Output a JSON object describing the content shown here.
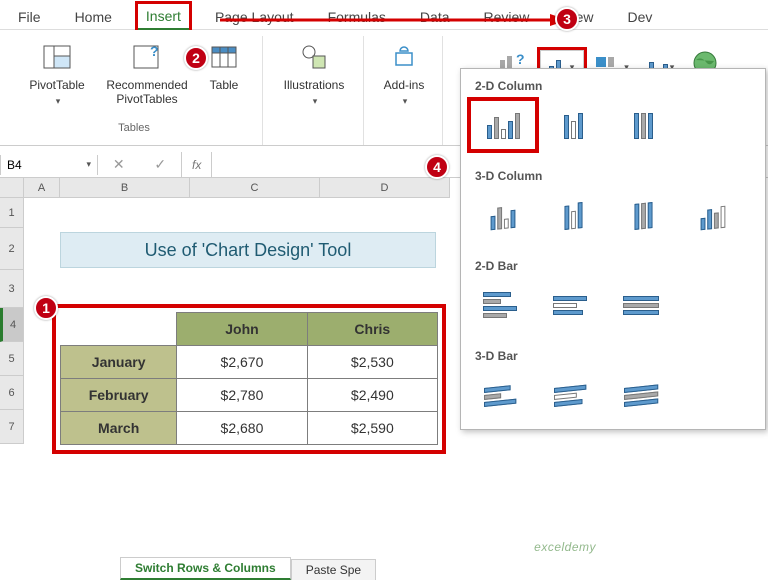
{
  "tabs": {
    "file": "File",
    "home": "Home",
    "insert": "Insert",
    "pagelayout": "Page Layout",
    "formulas": "Formulas",
    "data": "Data",
    "review": "Review",
    "view": "View",
    "dev": "Dev"
  },
  "ribbon": {
    "pivot": "PivotTable",
    "recpivot": "Recommended PivotTables",
    "table": "Table",
    "illus": "Illustrations",
    "addins": "Add-ins",
    "group_tables": "Tables"
  },
  "namebox": "B4",
  "fx": "fx",
  "title": "Use of 'Chart Design' Tool",
  "cols": [
    "A",
    "B",
    "C",
    "D"
  ],
  "rows": [
    "1",
    "2",
    "3",
    "4",
    "5",
    "6",
    "7"
  ],
  "table": {
    "headers": [
      "",
      "John",
      "Chris"
    ],
    "rows": [
      [
        "January",
        "$2,670",
        "$2,530"
      ],
      [
        "February",
        "$2,780",
        "$2,490"
      ],
      [
        "March",
        "$2,680",
        "$2,590"
      ]
    ]
  },
  "chartdd": {
    "h1": "2-D Column",
    "h2": "3-D Column",
    "h3": "2-D Bar",
    "h4": "3-D Bar"
  },
  "sheettabs": {
    "t1": "Switch Rows & Columns",
    "t2": "Paste Spe"
  },
  "watermark": "exceldemy",
  "badges": {
    "b1": "1",
    "b2": "2",
    "b3": "3",
    "b4": "4"
  }
}
